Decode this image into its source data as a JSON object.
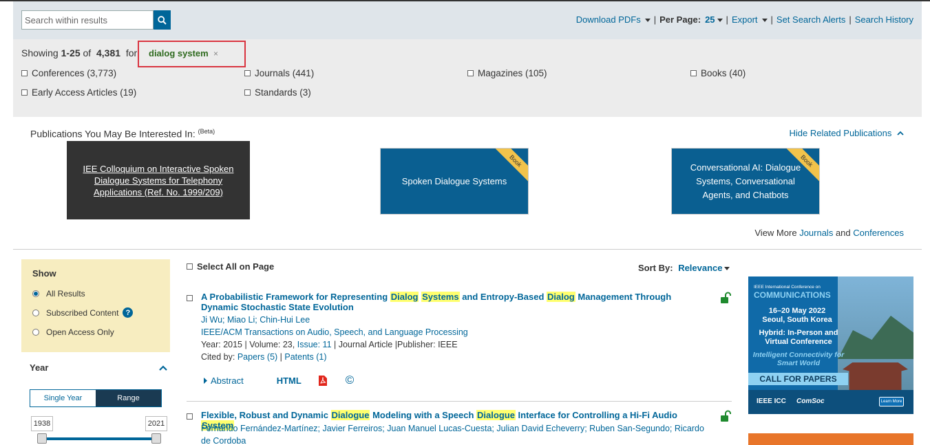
{
  "search": {
    "placeholder": "Search within results"
  },
  "toolbar": {
    "download_pdfs": "Download PDFs",
    "per_page_label": "Per Page:",
    "per_page_value": "25",
    "export": "Export",
    "set_alerts": "Set Search Alerts",
    "search_history": "Search History"
  },
  "results_summary": {
    "showing": "Showing",
    "range": "1-25",
    "of": "of",
    "total": "4,381",
    "for": "for",
    "query": "dialog system",
    "remove_glyph": "×"
  },
  "filters": [
    {
      "label": "Conferences (3,773)"
    },
    {
      "label": "Journals (441)"
    },
    {
      "label": "Magazines (105)"
    },
    {
      "label": "Books (40)"
    },
    {
      "label": "Early Access Articles (19)"
    },
    {
      "label": "Standards (3)"
    }
  ],
  "related": {
    "title": "Publications You May Be Interested In:",
    "beta": "(Beta)",
    "hide_label": "Hide Related Publications",
    "items": [
      {
        "title": "IEE Colloquium on Interactive Spoken Dialogue Systems for Telephony Applications (Ref. No. 1999/209)"
      },
      {
        "title": "Spoken Dialogue Systems",
        "badge": "Book"
      },
      {
        "title": "Conversational AI: Dialogue Systems, Conversational Agents, and Chatbots",
        "badge": "Book"
      }
    ],
    "view_more": "View More",
    "journals": "Journals",
    "and": "and",
    "conferences": "Conferences"
  },
  "sidebar": {
    "show_title": "Show",
    "show_options": [
      {
        "label": "All Results",
        "selected": true
      },
      {
        "label": "Subscribed Content",
        "selected": false
      },
      {
        "label": "Open Access Only",
        "selected": false
      }
    ],
    "help_glyph": "?",
    "year_title": "Year",
    "year_modes": [
      "Single Year",
      "Range"
    ],
    "year_mode_selected": "Range",
    "year_from": "1938",
    "year_to": "2021"
  },
  "results_header": {
    "select_all": "Select All on Page",
    "sort_label": "Sort By:",
    "sort_value": "Relevance"
  },
  "results": [
    {
      "title_parts": [
        {
          "t": "A Probabilistic Framework for Representing ",
          "hl": false
        },
        {
          "t": "Dialog",
          "hl": true
        },
        {
          "t": " ",
          "hl": false
        },
        {
          "t": "Systems",
          "hl": true
        },
        {
          "t": " and Entropy-Based ",
          "hl": false
        },
        {
          "t": "Dialog",
          "hl": true
        },
        {
          "t": " Management Through Dynamic Stochastic State Evolution",
          "hl": false
        }
      ],
      "authors": "Ji Wu; Miao Li; Chin-Hui Lee",
      "venue": "IEEE/ACM Transactions on Audio, Speech, and Language Processing",
      "year_label": "Year: 2015",
      "volume_label": "Volume: 23,",
      "issue_label": "Issue: 11",
      "type": "Journal Article",
      "publisher_label": "Publisher:",
      "publisher": "IEEE",
      "cited_label": "Cited by:",
      "cited_papers": "Papers (5)",
      "cited_patents": "Patents (1)",
      "abstract_label": "Abstract",
      "html_label": "HTML",
      "copyright_glyph": "©"
    },
    {
      "title_parts": [
        {
          "t": "Flexible, Robust and Dynamic ",
          "hl": false
        },
        {
          "t": "Dialogue",
          "hl": true
        },
        {
          "t": " Modeling with a Speech ",
          "hl": false
        },
        {
          "t": "Dialogue",
          "hl": true
        },
        {
          "t": " Interface for Controlling a Hi-Fi Audio ",
          "hl": false
        },
        {
          "t": "System",
          "hl": true
        }
      ],
      "authors": "Fernando Fernández-Martínez; Javier Ferreiros; Juan Manuel Lucas-Cuesta; Julian David Echeverry; Ruben San-Segundo; Ricardo de Cordoba"
    }
  ],
  "ad": {
    "conf_small": "IEEE International Conference on",
    "conf_big": "COMMUNICATIONS",
    "dates": "16–20 May 2022",
    "location": "Seoul, South Korea",
    "mode": "Hybrid: In-Person and Virtual Conference",
    "tagline": "Intelligent Connectivity for Smart World",
    "cfp": "CALL FOR PAPERS",
    "logo1": "IEEE ICC",
    "logo2": "ComSoc",
    "learn_more": "Learn More"
  },
  "colors": {
    "accent": "#006699",
    "highlight": "#ffff6e",
    "query_border": "#d9333f",
    "query_text": "#2e6a1e"
  }
}
